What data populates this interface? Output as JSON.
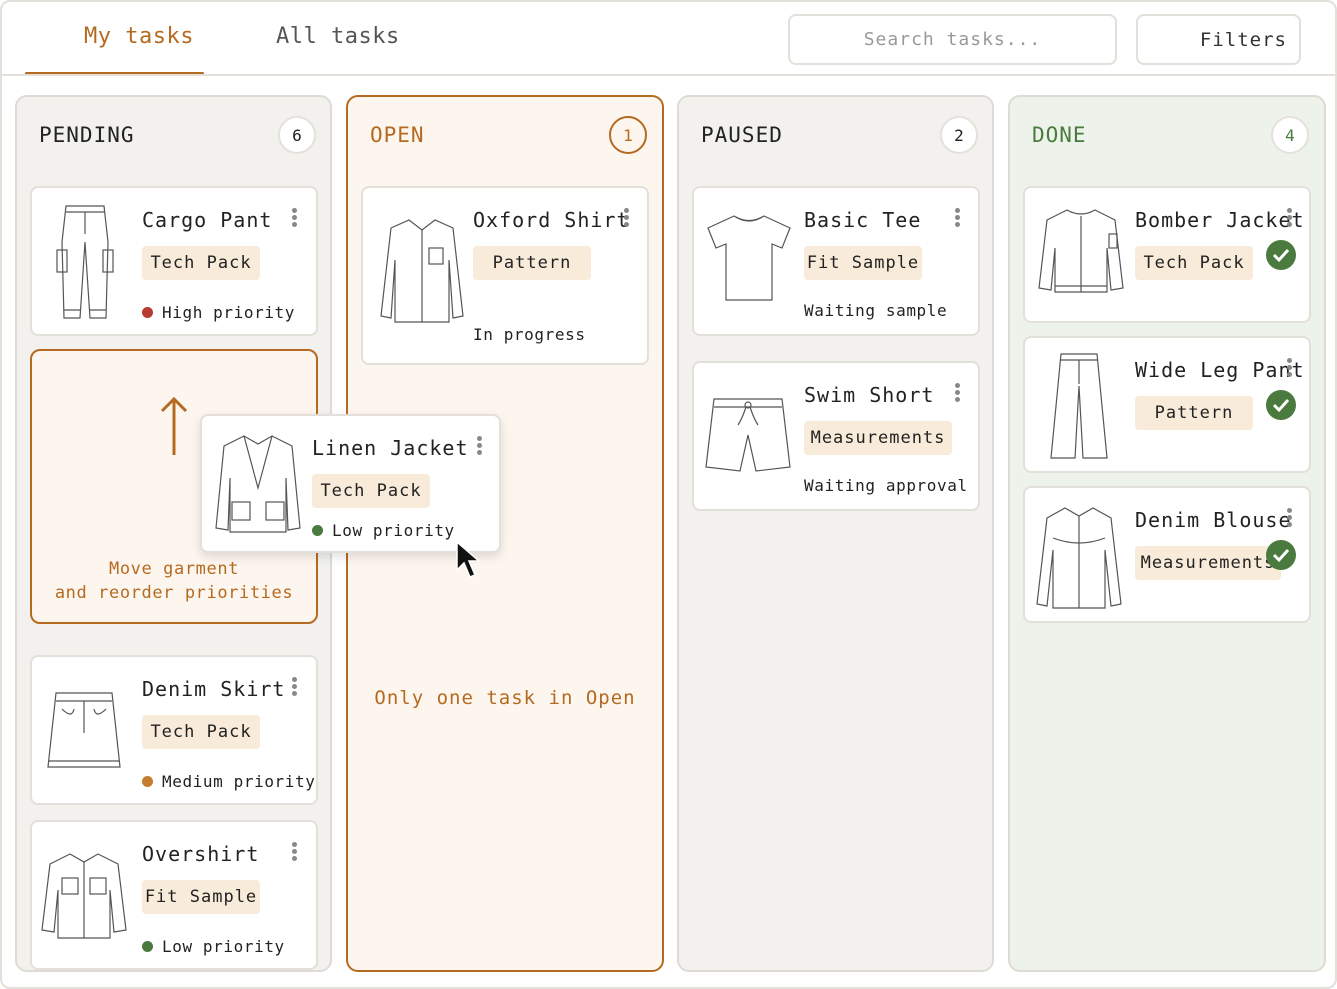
{
  "header": {
    "tabs": [
      {
        "label": "My tasks",
        "active": true
      },
      {
        "label": "All tasks",
        "active": false
      }
    ],
    "search_placeholder": "Search tasks...",
    "filters_label": "Filters"
  },
  "colors": {
    "accent": "#b56a21",
    "done_green": "#4a7a3e",
    "tag_bg": "#f8ebd9",
    "high": "#b83a32",
    "medium": "#c57c2e",
    "low": "#4a7a3e"
  },
  "columns": {
    "pending": {
      "title": "PENDING",
      "count": "6"
    },
    "open": {
      "title": "OPEN",
      "count": "1",
      "note": "Only one task in Open"
    },
    "paused": {
      "title": "PAUSED",
      "count": "2"
    },
    "done": {
      "title": "DONE",
      "count": "4"
    }
  },
  "pending_cards": [
    {
      "title": "Cargo Pant",
      "tag": "Tech Pack",
      "status": "High priority",
      "icon": "cargo-pant-icon"
    },
    {
      "title": "Denim Skirt",
      "tag": "Tech Pack",
      "status": "Medium priority",
      "icon": "denim-skirt-icon"
    },
    {
      "title": "Overshirt",
      "tag": "Fit Sample",
      "status": "Low priority",
      "icon": "overshirt-icon"
    }
  ],
  "dropzone": {
    "line1": "Move garment",
    "line2": "and reorder priorities"
  },
  "dragged_card": {
    "title": "Linen Jacket",
    "tag": "Tech Pack",
    "status": "Low priority",
    "icon": "linen-jacket-icon"
  },
  "open_cards": [
    {
      "title": "Oxford Shirt",
      "tag": "Pattern",
      "status": "In progress",
      "icon": "oxford-shirt-icon"
    }
  ],
  "paused_cards": [
    {
      "title": "Basic Tee",
      "tag": "Fit Sample",
      "status": "Waiting sample",
      "icon": "basic-tee-icon"
    },
    {
      "title": "Swim Short",
      "tag": "Measurements",
      "status": "Waiting approval",
      "icon": "swim-short-icon"
    }
  ],
  "done_cards": [
    {
      "title": "Bomber Jacket",
      "tag": "Tech Pack",
      "icon": "bomber-jacket-icon"
    },
    {
      "title": "Wide Leg Pant",
      "tag": "Pattern",
      "icon": "wide-leg-pant-icon"
    },
    {
      "title": "Denim Blouse",
      "tag": "Measurements",
      "icon": "denim-blouse-icon"
    }
  ]
}
